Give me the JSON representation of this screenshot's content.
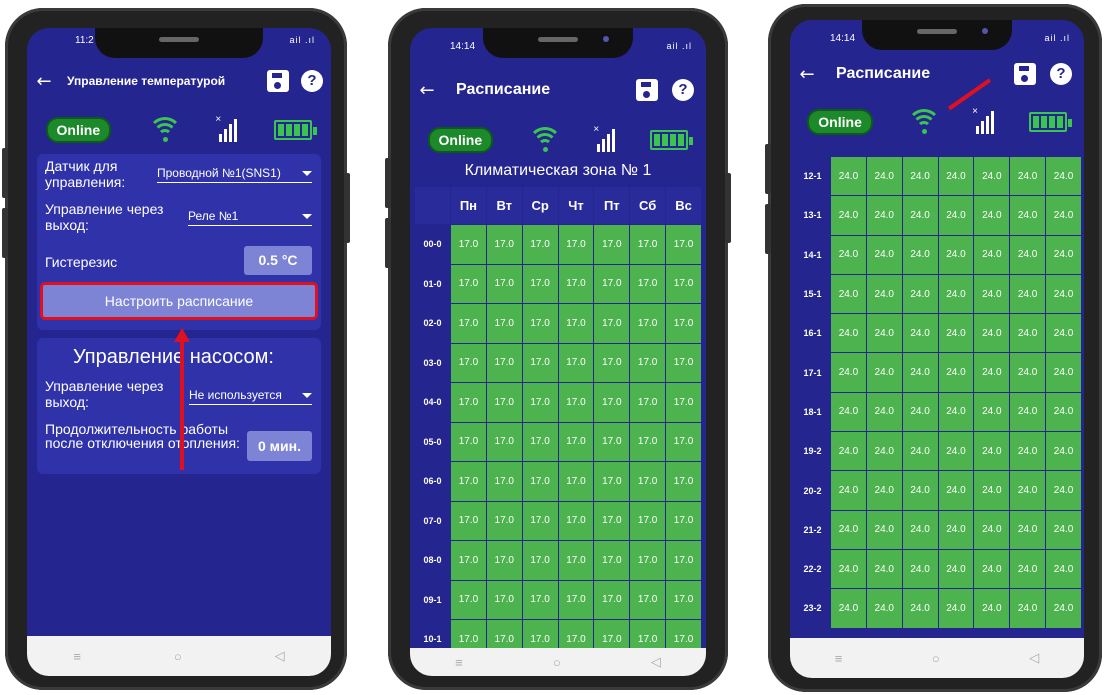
{
  "phone1": {
    "time": "11:2",
    "status_icons": "ail .ıl",
    "title": "Управление температурой",
    "online": "Online",
    "sensor_label": "Датчик для управления:",
    "sensor_value": "Проводной №1(SNS1)",
    "output_label": "Управление через выход:",
    "output_value": "Реле №1",
    "hyst_label": "Гистерезис",
    "hyst_value": "0.5 °C",
    "schedule_button": "Настроить расписание",
    "pump_title": "Управление насосом:",
    "pump_output_label": "Управление через выход:",
    "pump_output_value": "Не используется",
    "duration_label": "Продолжительность работы после отключения отопления:",
    "duration_value": "0 мин."
  },
  "phone2": {
    "time": "14:14",
    "status_icons": "ail .ıl",
    "title": "Расписание",
    "online": "Online",
    "zone": "Климатическая зона № 1",
    "days": [
      "Пн",
      "Вт",
      "Ср",
      "Чт",
      "Пт",
      "Сб",
      "Вс"
    ],
    "hours": [
      "00-0",
      "01-0",
      "02-0",
      "03-0",
      "04-0",
      "05-0",
      "06-0",
      "07-0",
      "08-0",
      "09-1",
      "10-1"
    ],
    "value": "17.0"
  },
  "phone3": {
    "time": "14:14",
    "status_icons": "ail .ıl",
    "title": "Расписание",
    "online": "Online",
    "hours": [
      "12-1",
      "13-1",
      "14-1",
      "15-1",
      "16-1",
      "17-1",
      "18-1",
      "19-2",
      "20-2",
      "21-2",
      "22-2",
      "23-2"
    ],
    "value": "24.0"
  },
  "nav": {
    "recent": "≡",
    "home": "○",
    "back": "◁"
  },
  "colors": {
    "screen": "#24258f",
    "cell": "#4db34f",
    "online": "#1c8a2a",
    "highlight": "#e01020"
  }
}
